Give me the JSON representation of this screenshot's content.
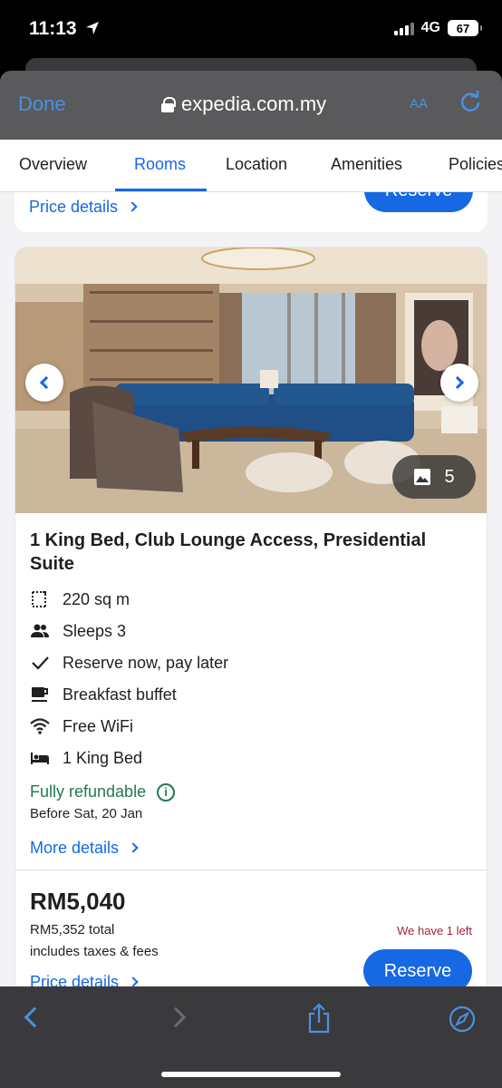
{
  "status_bar": {
    "time": "11:13",
    "network": "4G",
    "battery": "67"
  },
  "browser": {
    "done_label": "Done",
    "url": "expedia.com.my",
    "aa_label": "AA"
  },
  "tabs": [
    {
      "label": "Overview"
    },
    {
      "label": "Rooms"
    },
    {
      "label": "Location"
    },
    {
      "label": "Amenities"
    },
    {
      "label": "Policies"
    }
  ],
  "previous_card": {
    "price_details": "Price details",
    "reserve": "Reserve"
  },
  "room": {
    "photo_count": "5",
    "title": "1 King Bed, Club Lounge Access, Presidential Suite",
    "features": [
      {
        "icon": "area-icon",
        "label": "220 sq m"
      },
      {
        "icon": "people-icon",
        "label": "Sleeps 3"
      },
      {
        "icon": "check-icon",
        "label": "Reserve now, pay later"
      },
      {
        "icon": "coffee-icon",
        "label": "Breakfast buffet"
      },
      {
        "icon": "wifi-icon",
        "label": "Free WiFi"
      },
      {
        "icon": "bed-icon",
        "label": "1 King Bed"
      }
    ],
    "refundable": "Fully refundable",
    "refund_deadline": "Before Sat, 20 Jan",
    "more_details": "More details",
    "price": "RM5,040",
    "total": "RM5,352 total",
    "taxes": "includes taxes & fees",
    "availability": "We have 1 left",
    "price_details": "Price details",
    "reserve": "Reserve"
  },
  "colors": {
    "link": "#1668e3",
    "refundable": "#227950",
    "availability": "#a81f3b",
    "safari_accent": "#4a90e2"
  }
}
